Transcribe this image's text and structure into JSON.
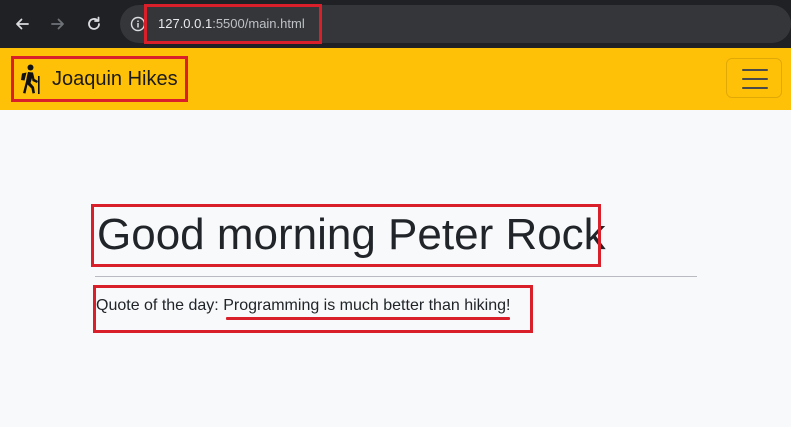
{
  "browser": {
    "url_host": "127.0.0.1",
    "url_rest": ":5500/main.html"
  },
  "navbar": {
    "brand_icon": "hiking-person-icon",
    "brand_name": "Joaquin Hikes",
    "toggler_icon": "hamburger-menu-icon",
    "background_color": "#ffc107"
  },
  "main": {
    "greeting": "Good morning Peter Rock",
    "quote_label": "Quote of the day: ",
    "quote_text": "Programming is much better than hiking",
    "quote_end": "!"
  },
  "annotation_color": "#d9202a"
}
